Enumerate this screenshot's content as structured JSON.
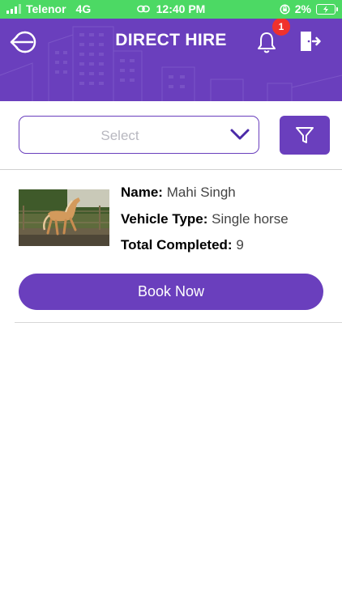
{
  "status_bar": {
    "carrier": "Telenor",
    "network": "4G",
    "time": "12:40 PM",
    "battery": "2%"
  },
  "header": {
    "title": "DIRECT HIRE",
    "notification_count": "1",
    "icons": [
      "back-arrow-icon",
      "bell-icon",
      "logout-icon"
    ]
  },
  "filter": {
    "select_placeholder": "Select",
    "icons": [
      "chevron-down-icon",
      "filter-icon"
    ]
  },
  "listing": {
    "name_label": "Name:",
    "name_value": "Mahi Singh",
    "vehicle_label": "Vehicle Type:",
    "vehicle_value": "Single horse",
    "completed_label": "Total Completed:",
    "completed_value": "9",
    "book_label": "Book Now"
  },
  "colors": {
    "primary": "#6a3fbd",
    "status_bar": "#4cd964",
    "badge": "#f0312d"
  }
}
